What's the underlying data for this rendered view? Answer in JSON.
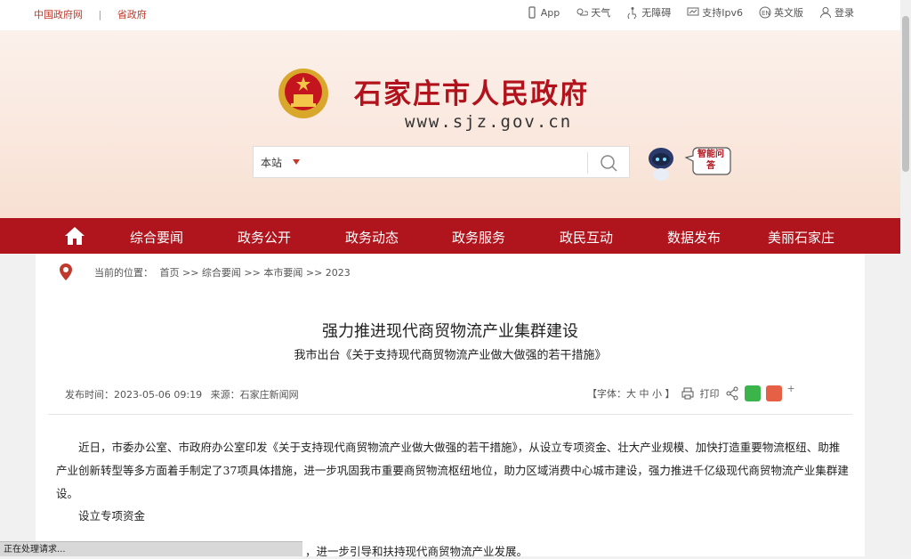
{
  "topbar": {
    "left_links": [
      "中国政府网",
      "省政府"
    ],
    "separator": "|",
    "right_links": [
      {
        "label": "App",
        "icon": "phone-icon"
      },
      {
        "label": "天气",
        "icon": "weather-icon"
      },
      {
        "label": "无障碍",
        "icon": "accessibility-icon"
      },
      {
        "label": "支持Ipv6",
        "icon": "ipv6-icon"
      },
      {
        "label": "英文版",
        "icon": "english-icon"
      },
      {
        "label": "登录",
        "icon": "user-icon"
      }
    ]
  },
  "header": {
    "title": "石家庄市人民政府",
    "url": "www.sjz.gov.cn",
    "search_scope": "本站",
    "assistant_label": "智能问答"
  },
  "nav": {
    "items": [
      "综合要闻",
      "政务公开",
      "政务动态",
      "政务服务",
      "政民互动",
      "数据发布",
      "美丽石家庄"
    ]
  },
  "breadcrumb": {
    "prefix": "当前的位置：",
    "path": "首页 >> 综合要闻 >> 本市要闻 >> 2023"
  },
  "article": {
    "title": "强力推进现代商贸物流产业集群建设",
    "subtitle": "我市出台《关于支持现代商贸物流产业做大做强的若干措施》",
    "publish_time": "发布时间：2023-05-06 09:19",
    "source": "来源：石家庄新闻网",
    "font_size_label": "【字体：大 中 小 】",
    "print_label": "打印",
    "paragraph1": "近日，市委办公室、市政府办公室印发《关于支持现代商贸物流产业做大做强的若干措施》，从设立专项资金、壮大产业规模、加快打造重要物流枢纽、助推产业创新转型等多方面着手制定了37项具体措施，进一步巩固我市重要商贸物流枢纽地位，助力区域消费中心城市建设，强力推进千亿级现代商贸物流产业集群建设。",
    "paragraph2": "设立专项资金",
    "paragraph3": "，进一步引导和扶持现代商贸物流产业发展。"
  },
  "status_bar": "正在处理请求..."
}
